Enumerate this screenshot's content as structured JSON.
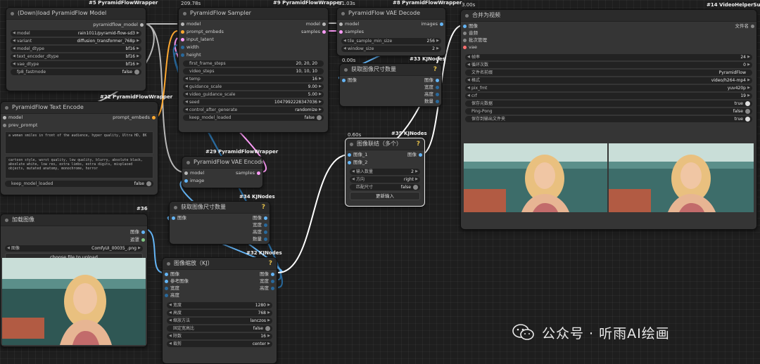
{
  "colors": {
    "canvas": "#1e1e1e",
    "node_bg": "#353535",
    "title_bg": "#2b2b2b",
    "wire_model": "#b8b8b8",
    "wire_latent": "#ff9cf9",
    "wire_image": "#64b5f6",
    "wire_cond": "#ffa931",
    "wire_int": "#29699c",
    "help": "#e6c14a"
  },
  "nodes": {
    "model_loader": {
      "tag": "#5 PyramidFlowWrapper",
      "title": "(Down)load PyramidFlow Model",
      "out": "pyramidflow_model",
      "widgets": [
        {
          "l": "model",
          "v": "rain1011/pyramid-flow-sd3"
        },
        {
          "l": "variant",
          "v": "diffusion_transformer_768p"
        },
        {
          "l": "model_dtype",
          "v": "bf16"
        },
        {
          "l": "text_encoder_dtype",
          "v": "bf16"
        },
        {
          "l": "vae_dtype",
          "v": "bf16"
        }
      ],
      "toggle": {
        "l": "fp8_fastmode",
        "v": "false"
      }
    },
    "text_encode": {
      "tag": "#22 PyramidFlowWrapper",
      "title": "PyramidFlow Text Encode",
      "in": [
        "model",
        "prev_prompt"
      ],
      "out": "prompt_embeds",
      "pos": "a woman smiles in front of the audience, hyper quality, Ultra HD, 8K",
      "neg": "cartoon style, worst quality, low quality, blurry, absolute black, absolute white, low res, extra limbs, extra digits, misplaced objects, mutated anatomy, monochrome, horror",
      "toggle": {
        "l": "keep_model_loaded",
        "v": "false"
      }
    },
    "load_image": {
      "tag": "#36",
      "title": "加载图像",
      "outs": [
        "图像",
        "遮罩"
      ],
      "combo": {
        "l": "图像",
        "v": "ComfyUI_00035_.png"
      },
      "button": "choose file to upload"
    },
    "sampler": {
      "time": "209.78s",
      "tag": "#9 PyramidFlowWrapper",
      "title": "PyramidFlow Sampler",
      "ins": [
        "model",
        "prompt_embeds",
        "input_latent",
        "width",
        "height"
      ],
      "outs": [
        "model",
        "samples"
      ],
      "widgets": [
        {
          "l": "first_frame_steps",
          "v": "20, 20, 20",
          "plain": true
        },
        {
          "l": "video_steps",
          "v": "10, 10, 10",
          "plain": true
        },
        {
          "l": "temp",
          "v": "16"
        },
        {
          "l": "guidance_scale",
          "v": "9.00"
        },
        {
          "l": "video_guidance_scale",
          "v": "5.00"
        },
        {
          "l": "seed",
          "v": "1047992228347036"
        },
        {
          "l": "control_after_generate",
          "v": "randomize"
        }
      ],
      "toggle": {
        "l": "keep_model_loaded",
        "v": "false"
      }
    },
    "vae_encode": {
      "tag": "#29 PyramidFlowWrapper",
      "title": "PyramidFlow VAE Encode",
      "ins": [
        "model",
        "image"
      ],
      "out": "samples"
    },
    "get_size_34": {
      "tag": "#34 KJNodes",
      "title": "获取图像尺寸数量",
      "in": "图像",
      "outs": [
        "图像",
        "宽度",
        "高度",
        "数量"
      ]
    },
    "resize_32": {
      "tag": "#32 KJNodes",
      "title": "图像缩放（KJ）",
      "ins": [
        "图像",
        "参考图像",
        "宽度",
        "高度"
      ],
      "outs": [
        "图像",
        "宽度",
        "高度"
      ],
      "widgets": [
        {
          "l": "宽度",
          "v": "1280"
        },
        {
          "l": "高度",
          "v": "768"
        },
        {
          "l": "缩放方法",
          "v": "lanczos"
        }
      ],
      "toggle": {
        "l": "固定宽高比",
        "v": "false"
      },
      "widgets2": [
        {
          "l": "除数",
          "v": "16"
        },
        {
          "l": "裁剪",
          "v": "center"
        }
      ]
    },
    "vae_decode": {
      "time": "31.03s",
      "tag": "#8 PyramidFlowWrapper",
      "title": "PyramidFlow VAE Decode",
      "ins": [
        "model",
        "samples"
      ],
      "out": "images",
      "widgets": [
        {
          "l": "tile_sample_min_size",
          "v": "256"
        },
        {
          "l": "window_size",
          "v": "2"
        }
      ]
    },
    "get_size_33": {
      "time": "0.00s",
      "tag": "#33 KJNodes",
      "title": "获取图像尺寸数量",
      "in": "图像",
      "outs": [
        "图像",
        "宽度",
        "高度",
        "数量"
      ]
    },
    "concat_35": {
      "time": "0.60s",
      "tag": "#35 KJNodes",
      "title": "图像联结（多个）",
      "ins": [
        "图像_1",
        "图像_2"
      ],
      "out": "图像",
      "widgets": [
        {
          "l": "输入数量",
          "v": "2"
        },
        {
          "l": "方向",
          "v": "right"
        }
      ],
      "toggle": {
        "l": "匹配尺寸",
        "v": "false"
      },
      "button": "更新输入"
    },
    "video_combine": {
      "time": "3.00s",
      "tag": "#14 VideoHelperSuite",
      "title": "合并为视频",
      "ins": [
        "图像",
        "音频",
        "批次管理",
        "vae"
      ],
      "out": "文件名",
      "widgets": [
        {
          "l": "帧率",
          "v": "24"
        },
        {
          "l": "循环次数",
          "v": "0"
        },
        {
          "l": "文件名前缀",
          "v": "PyramidFlow",
          "plain": true
        },
        {
          "l": "格式",
          "v": "video/h264-mp4"
        },
        {
          "l": "pix_fmt",
          "v": "yuv420p"
        },
        {
          "l": "crf",
          "v": "19"
        }
      ],
      "toggles": [
        {
          "l": "保存元数据",
          "v": "true"
        },
        {
          "l": "Ping-Pong",
          "v": "false"
        },
        {
          "l": "保存到输出文件夹",
          "v": "true"
        }
      ]
    }
  },
  "watermark": "公众号 · 听雨AI绘画"
}
